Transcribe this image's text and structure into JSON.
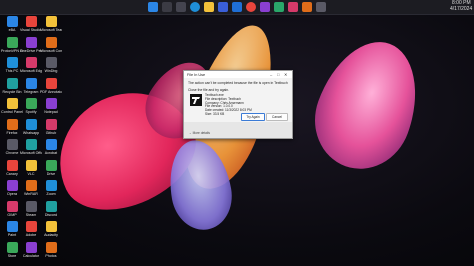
{
  "taskbar": {
    "clock_time": "8:00 PM",
    "clock_date": "4/17/2024",
    "colors": {
      "win": "#2b86e6",
      "edge": "#1f8fd9",
      "chrome": "#e8453c",
      "folder": "#f3c13a",
      "store": "#3a5fd9",
      "mail": "#1f6fd6"
    }
  },
  "desktop_icons": [
    {
      "label": "eBA"
    },
    {
      "label": "Visual Studio Code"
    },
    {
      "label": "Microsoft Teams"
    },
    {
      "label": "ProtonVPN Beta"
    },
    {
      "label": "OneDrive Personal"
    },
    {
      "label": "Microsoft Community"
    },
    {
      "label": "This PC"
    },
    {
      "label": "Microsoft Edge"
    },
    {
      "label": "WinDbg"
    },
    {
      "label": "Recycle Bin"
    },
    {
      "label": "Telegram"
    },
    {
      "label": "PDF Annotator"
    },
    {
      "label": "Control Panel"
    },
    {
      "label": "Spotify"
    },
    {
      "label": "Notepad"
    },
    {
      "label": "Firefox"
    },
    {
      "label": "Whatsapp"
    },
    {
      "label": "Github"
    },
    {
      "label": "Chrome"
    },
    {
      "label": "Microsoft Office"
    },
    {
      "label": "Acrobat"
    },
    {
      "label": "Canary"
    },
    {
      "label": "VLC"
    },
    {
      "label": "Drive"
    },
    {
      "label": "Opera"
    },
    {
      "label": "WinRAR"
    },
    {
      "label": "Zoom"
    },
    {
      "label": "GIMP"
    },
    {
      "label": "Steam"
    },
    {
      "label": "Discord"
    },
    {
      "label": "Paint"
    },
    {
      "label": "Adobe"
    },
    {
      "label": "Audacity"
    },
    {
      "label": "Store"
    },
    {
      "label": "Calculator"
    },
    {
      "label": "Photos"
    }
  ],
  "dialog": {
    "title": "File In Use",
    "message": "The action can't be completed because the file is open in Textbuch",
    "instruction": "Close the file and try again.",
    "file_name": "Textbuch.exe",
    "file_description": "File description: Textbuch",
    "company": "Company: Chris Ansemann",
    "file_version": "File version: 1.0.0.0",
    "date_created": "Date created: 11/3/2022 8:03 PM",
    "size": "Size: 33.5 KB",
    "try_again_label": "Try Again",
    "cancel_label": "Cancel",
    "more_details_label": "More details"
  }
}
